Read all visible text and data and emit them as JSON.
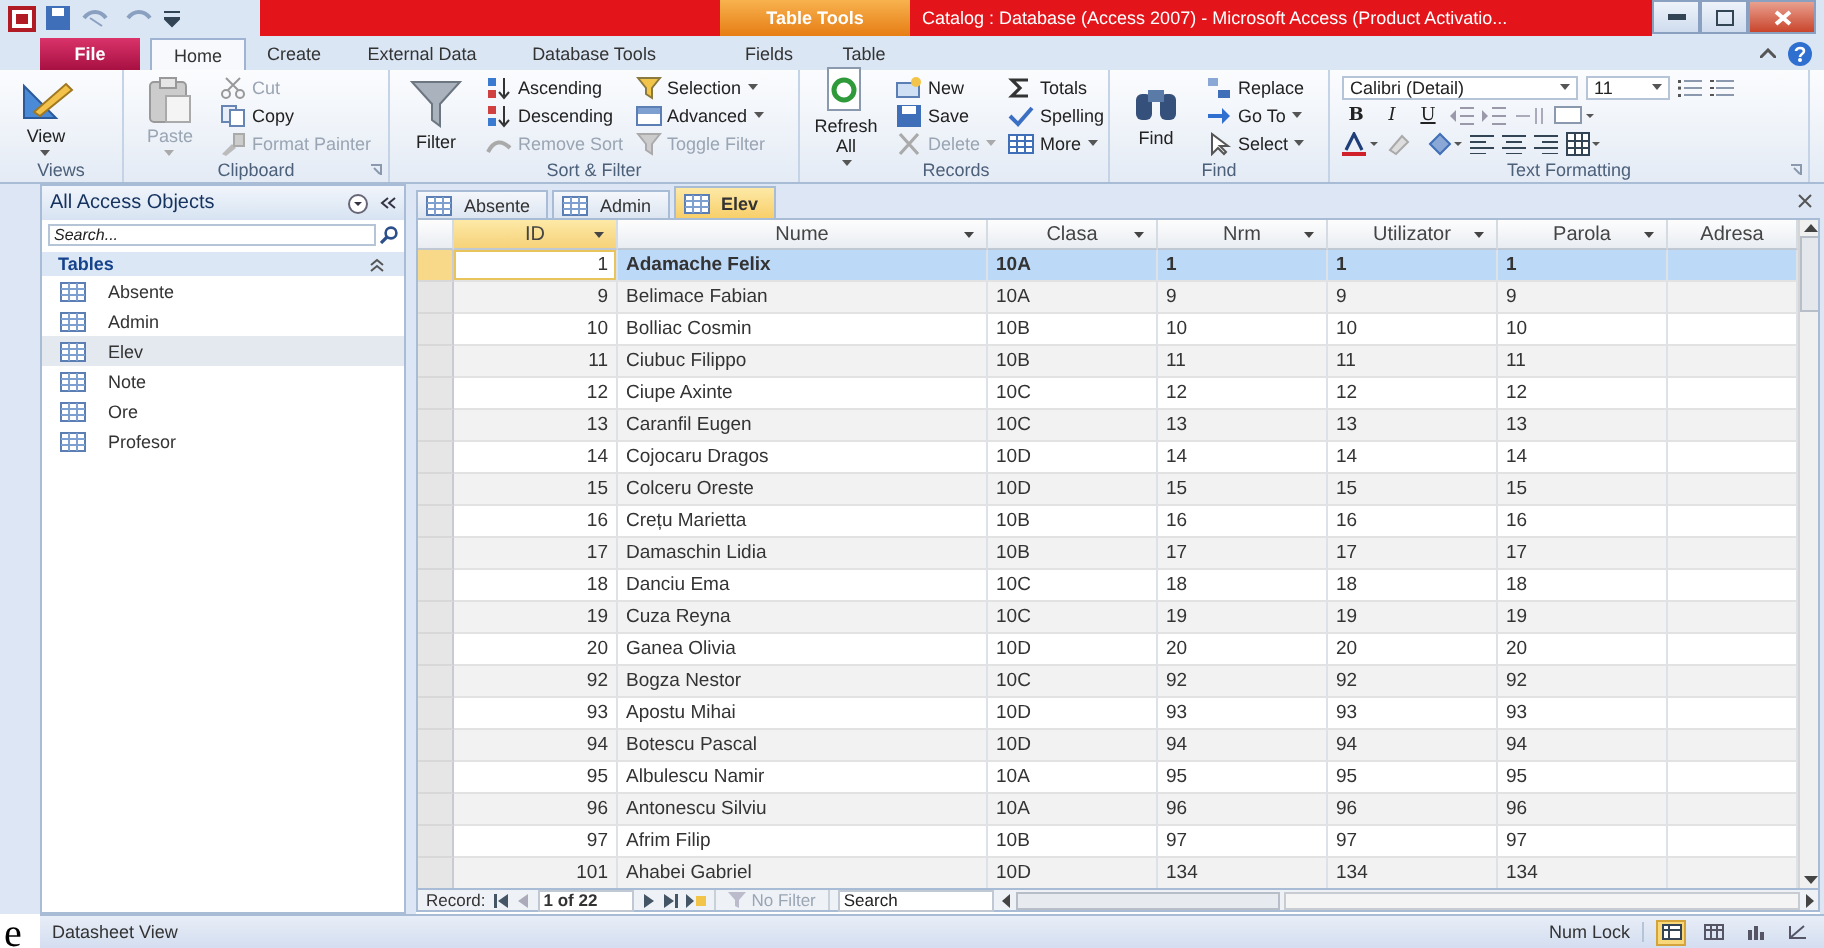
{
  "window": {
    "title": "Catalog : Database (Access 2007)  -  Microsoft Access (Product Activatio...",
    "context_tab": "Table Tools"
  },
  "ribbon_tabs": [
    {
      "label": "File",
      "kind": "file",
      "selected": false
    },
    {
      "label": "Home",
      "kind": "normal",
      "selected": true
    },
    {
      "label": "Create",
      "kind": "normal",
      "selected": false
    },
    {
      "label": "External Data",
      "kind": "normal",
      "selected": false
    },
    {
      "label": "Database Tools",
      "kind": "normal",
      "selected": false
    },
    {
      "label": "Fields",
      "kind": "context",
      "selected": false
    },
    {
      "label": "Table",
      "kind": "context",
      "selected": false
    }
  ],
  "ribbon_groups": [
    {
      "label": "Views",
      "kind": "buttons",
      "launcher": false,
      "items": [
        {
          "label": "View",
          "kind": "large",
          "dropdown": true,
          "disabled": false
        }
      ]
    },
    {
      "label": "Clipboard",
      "kind": "buttons",
      "launcher": true,
      "items": [
        {
          "label": "Paste",
          "kind": "large",
          "dropdown": true,
          "disabled": true
        },
        {
          "label": "Cut",
          "kind": "small",
          "dropdown": false,
          "disabled": true
        },
        {
          "label": "Copy",
          "kind": "small",
          "dropdown": false,
          "disabled": false
        },
        {
          "label": "Format Painter",
          "kind": "small",
          "dropdown": false,
          "disabled": true
        }
      ]
    },
    {
      "label": "Sort & Filter",
      "kind": "buttons",
      "launcher": false,
      "items": [
        {
          "label": "Filter",
          "kind": "large",
          "dropdown": false,
          "disabled": false
        },
        {
          "label": "Ascending",
          "kind": "small",
          "dropdown": false,
          "disabled": false
        },
        {
          "label": "Descending",
          "kind": "small",
          "dropdown": false,
          "disabled": false
        },
        {
          "label": "Remove Sort",
          "kind": "small",
          "dropdown": false,
          "disabled": true
        },
        {
          "label": "Selection",
          "kind": "small",
          "dropdown": true,
          "disabled": false
        },
        {
          "label": "Advanced",
          "kind": "small",
          "dropdown": true,
          "disabled": false
        },
        {
          "label": "Toggle Filter",
          "kind": "small",
          "dropdown": false,
          "disabled": true
        }
      ]
    },
    {
      "label": "Records",
      "kind": "buttons",
      "launcher": false,
      "items": [
        {
          "label": "Refresh All",
          "kind": "large",
          "dropdown": true,
          "disabled": false
        },
        {
          "label": "New",
          "kind": "small",
          "dropdown": false,
          "disabled": false
        },
        {
          "label": "Save",
          "kind": "small",
          "dropdown": false,
          "disabled": false
        },
        {
          "label": "Delete",
          "kind": "small",
          "dropdown": true,
          "disabled": true
        },
        {
          "label": "Totals",
          "kind": "small",
          "dropdown": false,
          "disabled": false
        },
        {
          "label": "Spelling",
          "kind": "small",
          "dropdown": false,
          "disabled": false
        },
        {
          "label": "More",
          "kind": "small",
          "dropdown": true,
          "disabled": false
        }
      ]
    },
    {
      "label": "Find",
      "kind": "buttons",
      "launcher": false,
      "items": [
        {
          "label": "Find",
          "kind": "large",
          "dropdown": false,
          "disabled": false
        },
        {
          "label": "Replace",
          "kind": "small",
          "dropdown": false,
          "disabled": false
        },
        {
          "label": "Go To",
          "kind": "small",
          "dropdown": true,
          "disabled": false
        },
        {
          "label": "Select",
          "kind": "small",
          "dropdown": true,
          "disabled": false
        }
      ]
    },
    {
      "label": "Text Formatting",
      "kind": "format",
      "launcher": true,
      "font": "Calibri (Detail)",
      "size": "11",
      "styles": [
        {
          "label": "B",
          "kind": "bold"
        },
        {
          "label": "I",
          "kind": "italic"
        },
        {
          "label": "U",
          "kind": "underline"
        }
      ]
    }
  ],
  "nav_pane": {
    "title": "All Access Objects",
    "search": {
      "placeholder": "Search..."
    },
    "section": "Tables",
    "items": [
      {
        "label": "Absente",
        "selected": false
      },
      {
        "label": "Admin",
        "selected": false
      },
      {
        "label": "Elev",
        "selected": true
      },
      {
        "label": "Note",
        "selected": false
      },
      {
        "label": "Ore",
        "selected": false
      },
      {
        "label": "Profesor",
        "selected": false
      }
    ]
  },
  "document_tabs": [
    {
      "label": "Absente",
      "selected": false
    },
    {
      "label": "Admin",
      "selected": false
    },
    {
      "label": "Elev",
      "selected": true
    }
  ],
  "table": {
    "columns": [
      {
        "label": "ID",
        "filter_arrow": true,
        "selected": true
      },
      {
        "label": "Nume",
        "filter_arrow": true,
        "selected": false
      },
      {
        "label": "Clasa",
        "filter_arrow": true,
        "selected": false
      },
      {
        "label": "Nrm",
        "filter_arrow": true,
        "selected": false
      },
      {
        "label": "Utilizator",
        "filter_arrow": true,
        "selected": false
      },
      {
        "label": "Parola",
        "filter_arrow": true,
        "selected": false
      },
      {
        "label": "Adresa",
        "filter_arrow": false,
        "selected": false
      }
    ],
    "rows": [
      {
        "cells": [
          "1",
          "Adamache Felix",
          "10A",
          "1",
          "1",
          "1"
        ],
        "selected": true
      },
      {
        "cells": [
          "9",
          "Belimace Fabian",
          "10A",
          "9",
          "9",
          "9"
        ],
        "selected": false
      },
      {
        "cells": [
          "10",
          "Bolliac Cosmin",
          "10B",
          "10",
          "10",
          "10"
        ],
        "selected": false
      },
      {
        "cells": [
          "11",
          "Ciubuc Filippo",
          "10B",
          "11",
          "11",
          "11"
        ],
        "selected": false
      },
      {
        "cells": [
          "12",
          "Ciupe Axinte",
          "10C",
          "12",
          "12",
          "12"
        ],
        "selected": false
      },
      {
        "cells": [
          "13",
          "Caranfil Eugen",
          "10C",
          "13",
          "13",
          "13"
        ],
        "selected": false
      },
      {
        "cells": [
          "14",
          "Cojocaru Dragos",
          "10D",
          "14",
          "14",
          "14"
        ],
        "selected": false
      },
      {
        "cells": [
          "15",
          "Colceru Oreste",
          "10D",
          "15",
          "15",
          "15"
        ],
        "selected": false
      },
      {
        "cells": [
          "16",
          "Crețu Marietta",
          "10B",
          "16",
          "16",
          "16"
        ],
        "selected": false
      },
      {
        "cells": [
          "17",
          "Damaschin Lidia",
          "10B",
          "17",
          "17",
          "17"
        ],
        "selected": false
      },
      {
        "cells": [
          "18",
          "Danciu Ema",
          "10C",
          "18",
          "18",
          "18"
        ],
        "selected": false
      },
      {
        "cells": [
          "19",
          "Cuza Reyna",
          "10C",
          "19",
          "19",
          "19"
        ],
        "selected": false
      },
      {
        "cells": [
          "20",
          "Ganea Olivia",
          "10D",
          "20",
          "20",
          "20"
        ],
        "selected": false
      },
      {
        "cells": [
          "92",
          "Bogza Nestor",
          "10C",
          "92",
          "92",
          "92"
        ],
        "selected": false
      },
      {
        "cells": [
          "93",
          "Apostu Mihai",
          "10D",
          "93",
          "93",
          "93"
        ],
        "selected": false
      },
      {
        "cells": [
          "94",
          "Botescu Pascal",
          "10D",
          "94",
          "94",
          "94"
        ],
        "selected": false
      },
      {
        "cells": [
          "95",
          "Albulescu Namir",
          "10A",
          "95",
          "95",
          "95"
        ],
        "selected": false
      },
      {
        "cells": [
          "96",
          "Antonescu Silviu",
          "10A",
          "96",
          "96",
          "96"
        ],
        "selected": false
      },
      {
        "cells": [
          "97",
          "Afrim Filip",
          "10B",
          "97",
          "97",
          "97"
        ],
        "selected": false
      },
      {
        "cells": [
          "101",
          "Ahabei Gabriel",
          "10D",
          "134",
          "134",
          "134"
        ],
        "selected": false
      }
    ]
  },
  "record_bar": {
    "label": "Record:",
    "position": "1 of 22",
    "filter": "No Filter",
    "search": {
      "placeholder": "Search"
    }
  },
  "status_bar": {
    "text": "Datasheet View",
    "indicator": "Num Lock",
    "view_buttons": [
      {
        "selected": true
      },
      {
        "selected": false
      },
      {
        "selected": false
      },
      {
        "selected": false
      }
    ]
  },
  "stray_text": "e"
}
